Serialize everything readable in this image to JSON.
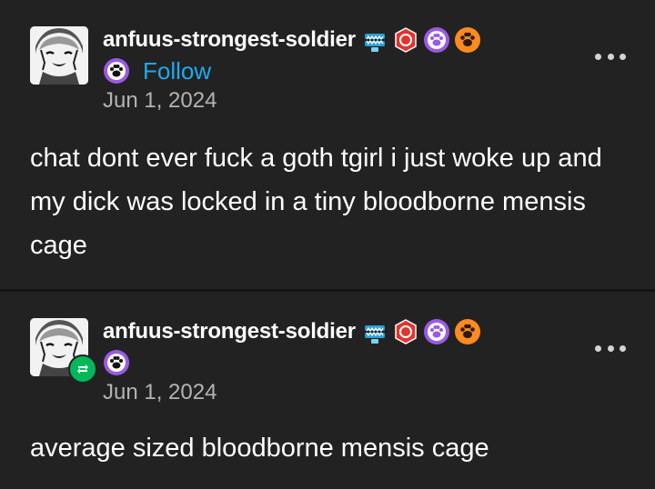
{
  "posts": [
    {
      "username": "anfuus-strongest-soldier",
      "follow_label": "Follow",
      "date": "Jun 1, 2024",
      "text": "chat dont ever fuck a goth tgirl i just woke up and my dick was locked in a tiny bloodborne mensis cage",
      "badges": [
        "wind-up-teeth-icon",
        "red-badge-icon",
        "purple-paw-icon",
        "orange-paw-icon"
      ],
      "reblog": false
    },
    {
      "username": "anfuus-strongest-soldier",
      "date": "Jun 1, 2024",
      "text": "average sized bloodborne mensis cage",
      "badges": [
        "wind-up-teeth-icon",
        "red-badge-icon",
        "purple-paw-icon",
        "orange-paw-icon"
      ],
      "reblog": true
    }
  ],
  "colors": {
    "background": "#222222",
    "follow": "#1ea9f0",
    "date": "#b3b3b3",
    "reblog": "#00b85a",
    "paw_purple": "#9b59e6",
    "paw_orange": "#ff8a1f",
    "badge_red": "#e0342f"
  }
}
